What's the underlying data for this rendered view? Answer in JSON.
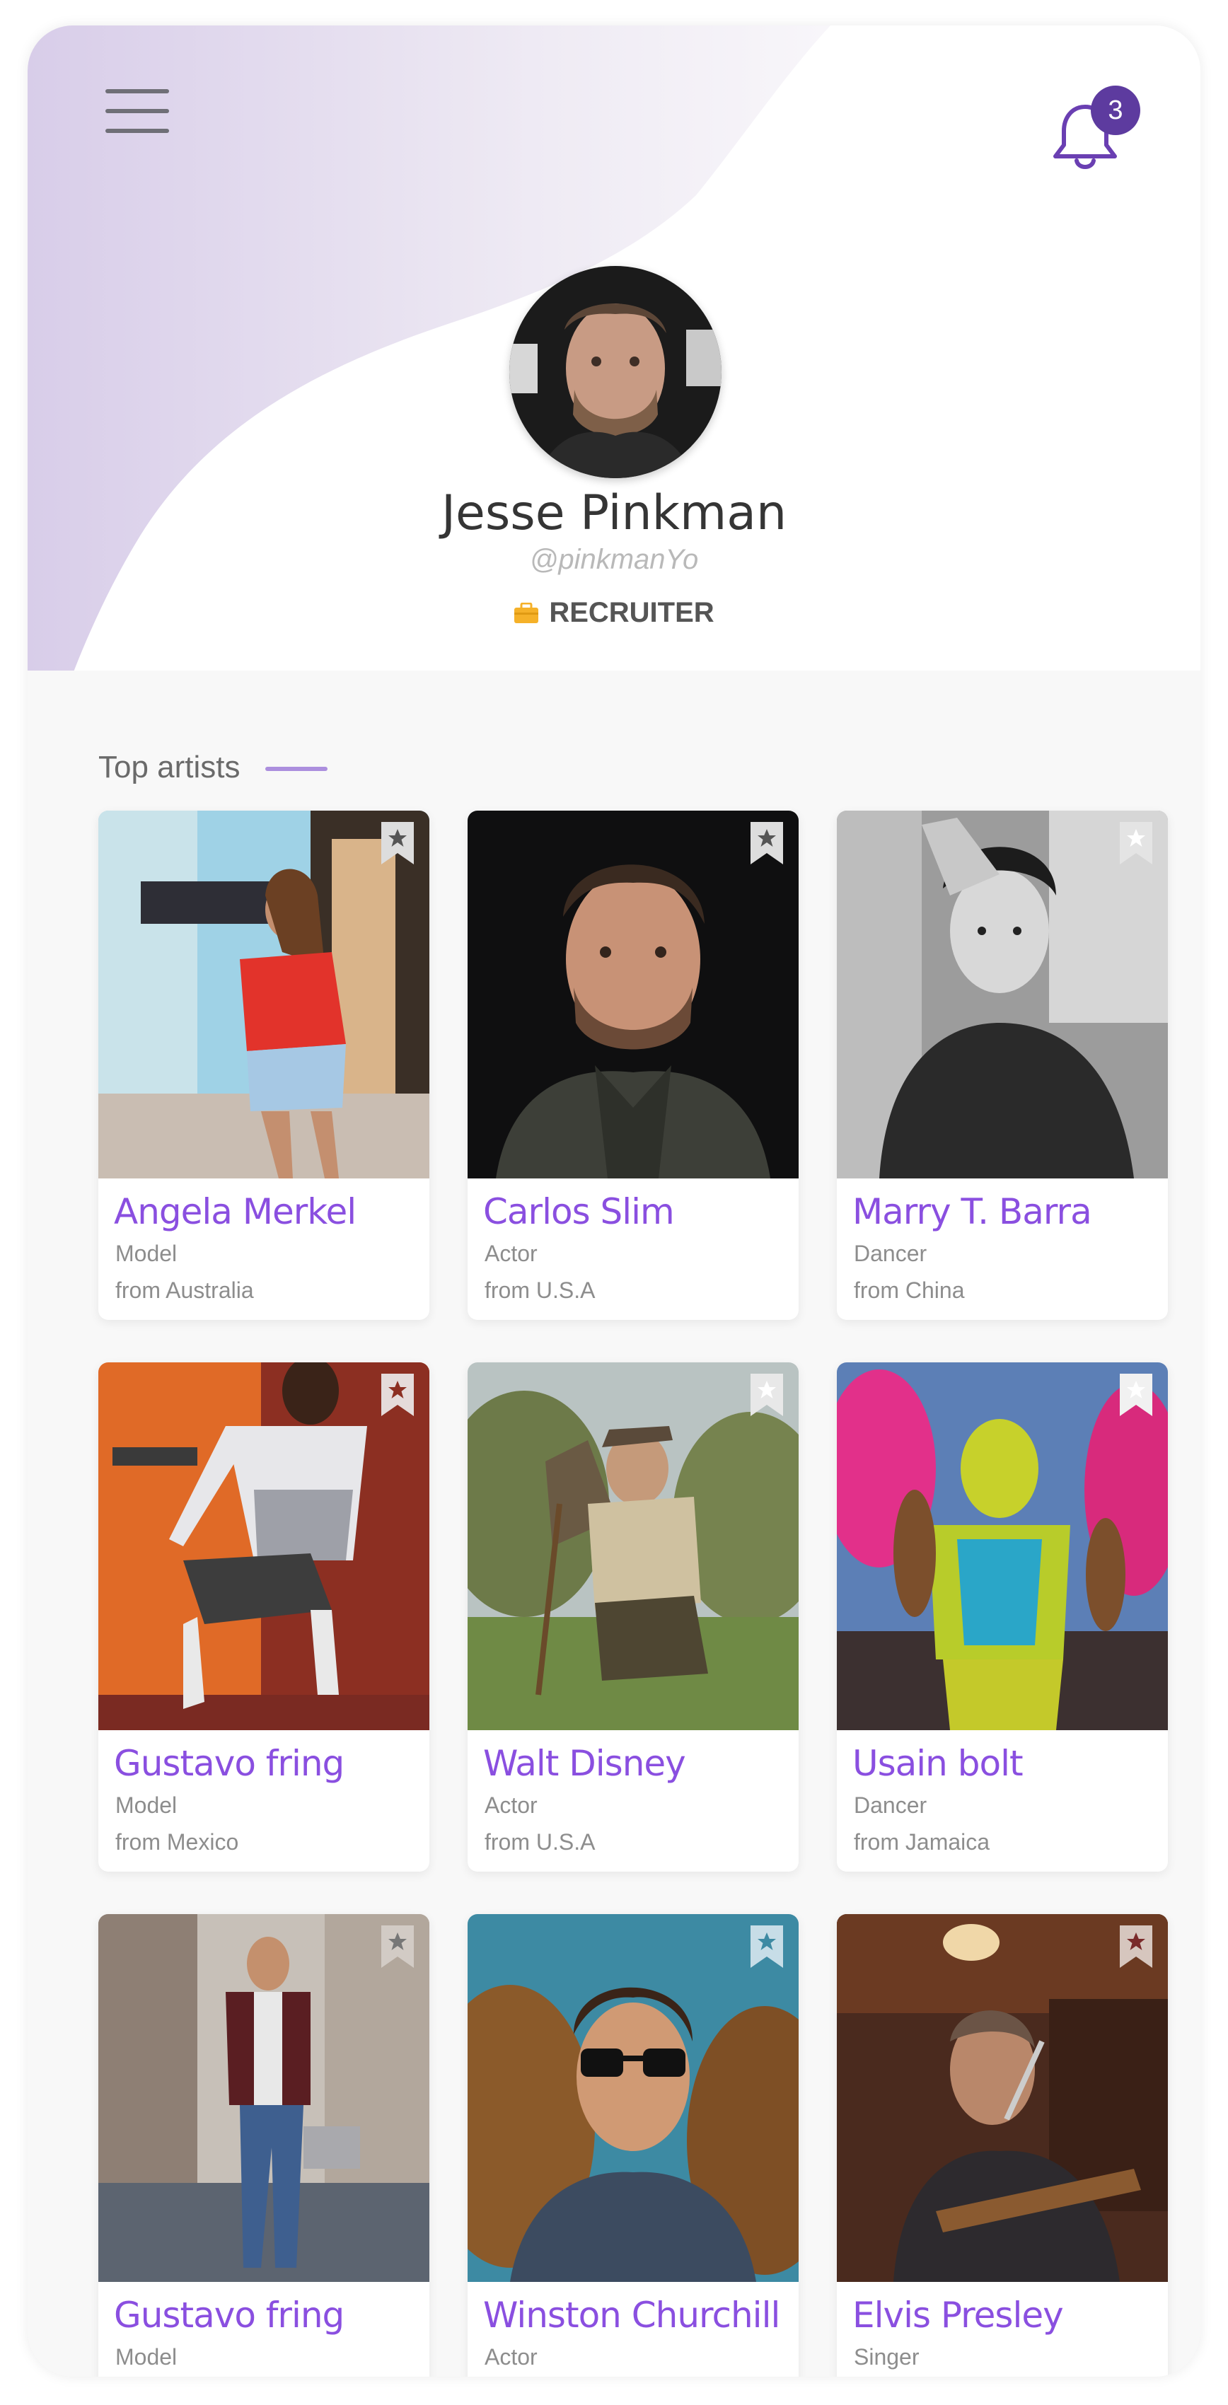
{
  "header": {
    "notification_count": "3",
    "profile": {
      "name": "Jesse Pinkman",
      "handle": "@pinkmanYo",
      "role": "RECRUITER"
    }
  },
  "colors": {
    "accent": "#8a4fe0",
    "badge": "#5d3b9f",
    "header_wave": "#ddd2ec",
    "role_icon": "#f5b129"
  },
  "section": {
    "title": "Top artists"
  },
  "artists": [
    {
      "name": "Angela Merkel",
      "role": "Model",
      "from": "from Australia",
      "bookmarked": false
    },
    {
      "name": "Carlos Slim",
      "role": "Actor",
      "from": "from U.S.A",
      "bookmarked": false
    },
    {
      "name": "Marry T. Barra",
      "role": "Dancer",
      "from": "from China",
      "bookmarked": false
    },
    {
      "name": "Gustavo fring",
      "role": "Model",
      "from": "from Mexico",
      "bookmarked": false
    },
    {
      "name": "Walt Disney",
      "role": "Actor",
      "from": "from U.S.A",
      "bookmarked": false
    },
    {
      "name": "Usain bolt",
      "role": "Dancer",
      "from": "from Jamaica",
      "bookmarked": false
    },
    {
      "name": "Gustavo fring",
      "role": "Model",
      "from": "",
      "bookmarked": false
    },
    {
      "name": "Winston Churchill",
      "role": "Actor",
      "from": "",
      "bookmarked": false
    },
    {
      "name": "Elvis Presley",
      "role": "Singer",
      "from": "",
      "bookmarked": false
    }
  ],
  "icons": {
    "menu": "hamburger-icon",
    "notifications": "bell-icon",
    "role": "briefcase-icon",
    "bookmark": "bookmark-star-icon"
  }
}
